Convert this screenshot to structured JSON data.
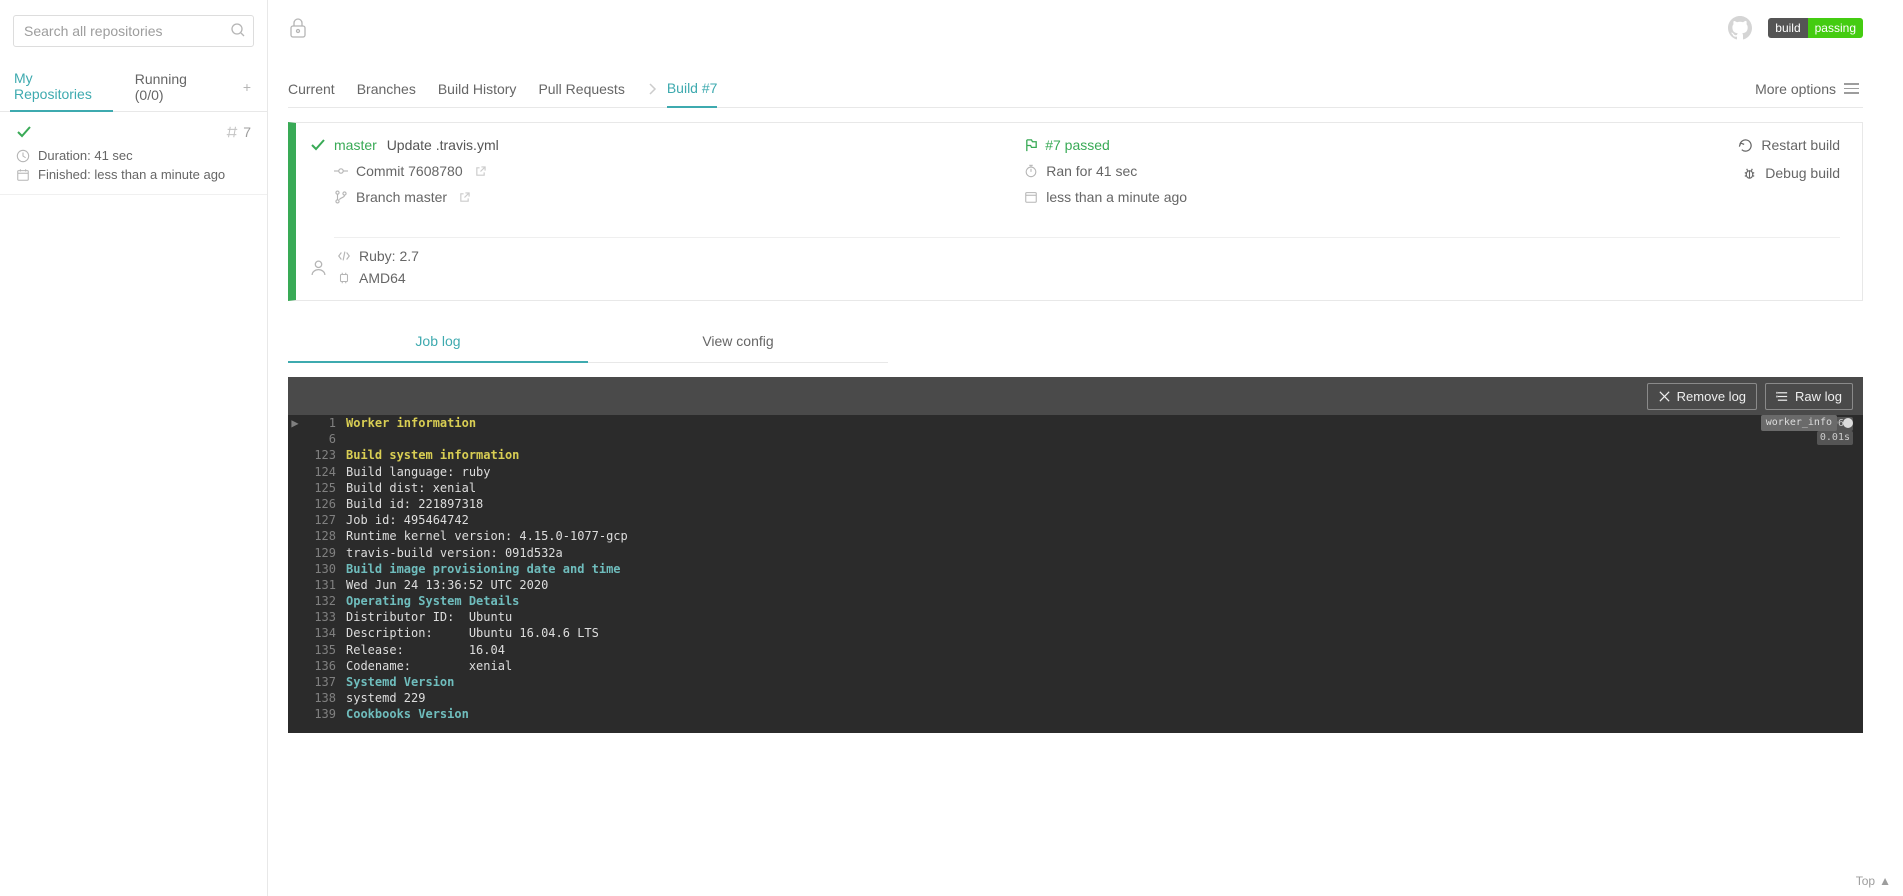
{
  "search": {
    "placeholder": "Search all repositories"
  },
  "side_tabs": {
    "mine": "My Repositories",
    "running": "Running (0/0)"
  },
  "repo": {
    "number": "7",
    "duration": "Duration: 41 sec",
    "finished": "Finished: less than a minute ago"
  },
  "badge": {
    "left": "build",
    "right": "passing"
  },
  "tabs": {
    "current": "Current",
    "branches": "Branches",
    "history": "Build History",
    "pulls": "Pull Requests",
    "build": "Build #7",
    "more": "More options"
  },
  "build": {
    "branch": "master",
    "message": "Update .travis.yml",
    "commit_label": "Commit ",
    "commit": "7608780",
    "branch_label": "Branch ",
    "branch_name": "master",
    "status": "#7 passed",
    "ran": "Ran for 41 sec",
    "ago": "less than a minute ago",
    "restart": "Restart build",
    "debug": "Debug build",
    "lang": "Ruby: 2.7",
    "arch": "AMD64"
  },
  "subtabs": {
    "log": "Job log",
    "config": "View config"
  },
  "logbtns": {
    "remove": "Remove log",
    "raw": "Raw log"
  },
  "log": {
    "tag_worker": "worker_info",
    "t1": "0.06s",
    "t2": "0.01s",
    "lines": [
      {
        "n": "1",
        "t": "Worker information",
        "cls": "h-yellow",
        "tri": true
      },
      {
        "n": "6",
        "t": ""
      },
      {
        "n": "123",
        "t": "Build system information",
        "cls": "h-yellow"
      },
      {
        "n": "124",
        "t": "Build language: ruby"
      },
      {
        "n": "125",
        "t": "Build dist: xenial"
      },
      {
        "n": "126",
        "t": "Build id: 221897318"
      },
      {
        "n": "127",
        "t": "Job id: 495464742"
      },
      {
        "n": "128",
        "t": "Runtime kernel version: 4.15.0-1077-gcp"
      },
      {
        "n": "129",
        "t": "travis-build version: 091d532a"
      },
      {
        "n": "130",
        "t": "Build image provisioning date and time",
        "cls": "h-teal"
      },
      {
        "n": "131",
        "t": "Wed Jun 24 13:36:52 UTC 2020"
      },
      {
        "n": "132",
        "t": "Operating System Details",
        "cls": "h-teal"
      },
      {
        "n": "133",
        "t": "Distributor ID:  Ubuntu"
      },
      {
        "n": "134",
        "t": "Description:     Ubuntu 16.04.6 LTS"
      },
      {
        "n": "135",
        "t": "Release:         16.04"
      },
      {
        "n": "136",
        "t": "Codename:        xenial"
      },
      {
        "n": "137",
        "t": "Systemd Version",
        "cls": "h-teal"
      },
      {
        "n": "138",
        "t": "systemd 229"
      },
      {
        "n": "139",
        "t": "Cookbooks Version",
        "cls": "h-teal"
      }
    ]
  },
  "toplink": "Top"
}
